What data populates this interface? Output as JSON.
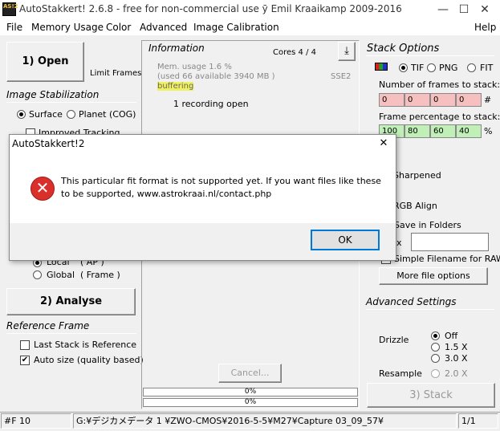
{
  "window": {
    "title": "AutoStakkert! 2.6.8 - free for non-commercial use ӯ Emil Kraaikamp 2009-2016",
    "icon_text": "AS!2",
    "minimize_glyph": "—",
    "maximize_glyph": "☐",
    "close_glyph": "✕"
  },
  "menu": {
    "file": "File",
    "memory_usage": "Memory Usage",
    "color": "Color",
    "advanced": "Advanced",
    "image_calibration": "Image Calibration",
    "help": "Help"
  },
  "left": {
    "open_button": "1) Open",
    "limit_frames": "Limit Frames",
    "image_stabilization": "Image Stabilization",
    "surface": "Surface",
    "planet": "Planet (COG)",
    "improved_tracking": "Improved Tracking",
    "local": "Local",
    "local_ap": "( AP )",
    "global": "Global",
    "global_frame": "( Frame )",
    "analyse_button": "2) Analyse",
    "reference_frame": "Reference Frame",
    "last_stack": "Last Stack is Reference",
    "auto_size": "Auto size (quality based)",
    "check_mark": "✔"
  },
  "info": {
    "heading": "Information",
    "cores": "Cores 4 / 4",
    "mem_usage": "Mem. usage 1.6 %",
    "mem_available": "(used 66 available 3940 MB )",
    "buffering": "buffering",
    "sse": "SSE2",
    "recording": "1 recording open",
    "cancel_button": "Cancel...",
    "progress_1": "0%",
    "progress_2": "0%"
  },
  "stack": {
    "heading": "Stack Options",
    "tif": "TIF",
    "png": "PNG",
    "fit": "FIT",
    "frames_label": "Number of frames to stack:",
    "frames": [
      "0",
      "0",
      "0",
      "0"
    ],
    "frames_suffix": "#",
    "percentage_label": "Frame percentage to stack:",
    "percentages": [
      "100",
      "80",
      "60",
      "40"
    ],
    "percentage_suffix": "%",
    "sharpened": "Sharpened",
    "rgb_align": "RGB Align",
    "save_in_folders": "Save in Folders",
    "prefix": "ix",
    "simple_filename": "Simple Filename for RAW",
    "more_file_options": "More file options",
    "advanced_settings": "Advanced Settings",
    "drizzle": "Drizzle",
    "drizzle_off": "Off",
    "drizzle_15": "1.5 X",
    "drizzle_30": "3.0 X",
    "resample": "Resample",
    "resample_20": "2.0 X",
    "stack_button": "3) Stack"
  },
  "dialog": {
    "title": "AutoStakkert!2",
    "close_glyph": "✕",
    "error_glyph": "✕",
    "message_line1": "This particular fit format is not supported yet. If you want files like these",
    "message_line2": "to be supported, www.astrokraai.nl/contact.php",
    "ok_button": "OK"
  },
  "status": {
    "frame": "#F 10",
    "path": "G:¥デジカメデータ 1 ¥ZWO-CMOS¥2016-5-5¥M27¥Capture 03_09_57¥",
    "page": "1/1"
  }
}
